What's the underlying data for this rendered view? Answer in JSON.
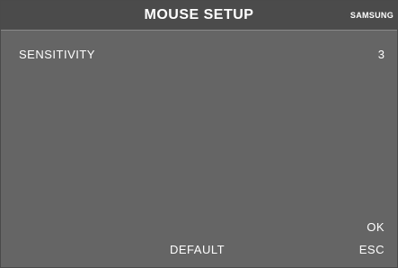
{
  "header": {
    "title": "MOUSE SETUP",
    "brand": "SAMSUNG"
  },
  "settings": {
    "sensitivity_label": "SENSITIVITY",
    "sensitivity_value": "3"
  },
  "buttons": {
    "ok_label": "OK",
    "default_label": "DEFAULT",
    "esc_label": "ESC"
  },
  "colors": {
    "background": "#656565",
    "title_bar": "#4b4b4b",
    "text": "#ffffff"
  }
}
